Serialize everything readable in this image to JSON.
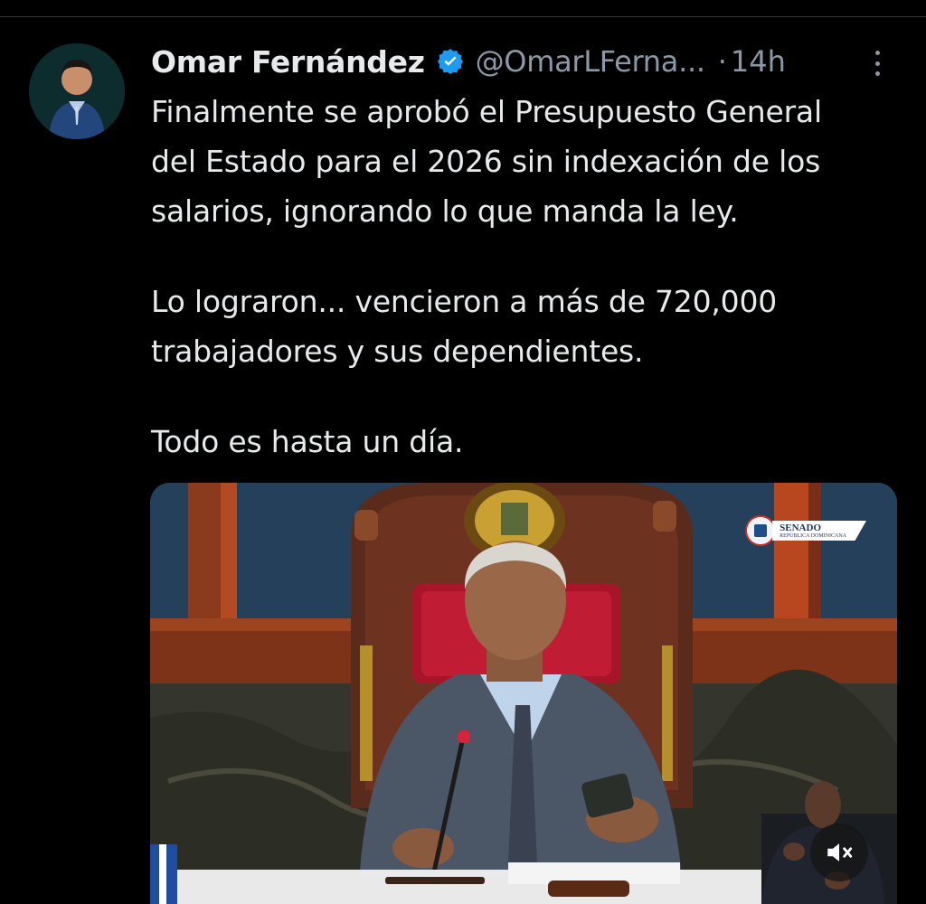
{
  "tweet": {
    "author": {
      "name": "Omar Fernández",
      "handle": "@OmarLFerna...",
      "verified": true
    },
    "separator": "·",
    "time": "14h",
    "text": {
      "paragraph1": {
        "line1": "Finalmente se aprobó el Presupuesto General",
        "line2": "del Estado para el 2026 sin indexación de los",
        "line3": "salarios, ignorando lo que manda la ley."
      },
      "paragraph2": {
        "line1": "Lo lograron... vencieron a más de 720,000",
        "line2": "trabajadores y sus dependientes."
      },
      "paragraph3": {
        "line1": "Todo es hasta un día."
      }
    },
    "media": {
      "type": "video",
      "watermark": {
        "line1": "SENADO",
        "line2": "REPÚBLICA DOMINICANA"
      },
      "muted": true
    }
  },
  "colors": {
    "background": "#000000",
    "text_primary": "#e7e9ea",
    "text_secondary": "#8b98a5",
    "verified_badge": "#1d9bf0",
    "divider": "#2f3336"
  },
  "icons": {
    "verified": "verified-badge-icon",
    "more": "more-vertical-icon",
    "mute": "speaker-muted-icon"
  }
}
